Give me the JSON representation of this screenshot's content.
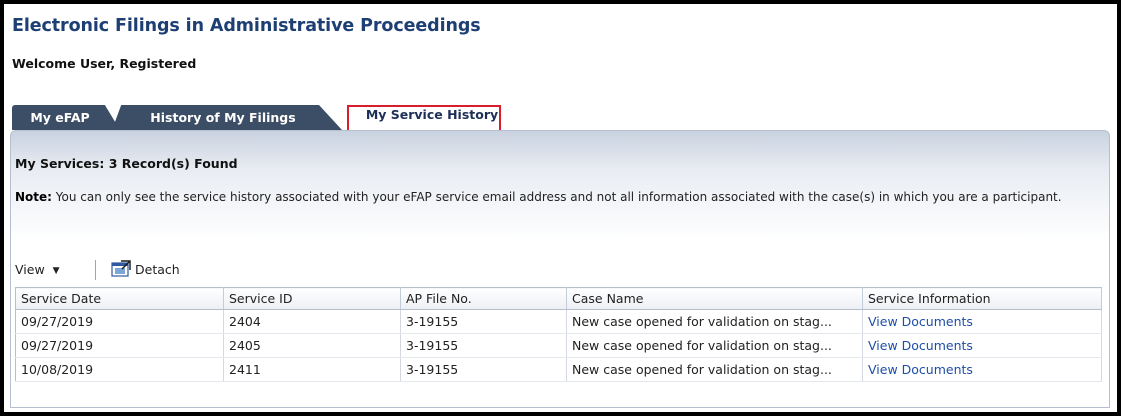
{
  "app": {
    "title": "Electronic Filings in Administrative Proceedings",
    "welcome": "Welcome User, Registered"
  },
  "tabs": [
    {
      "label": "My eFAP",
      "selected": false
    },
    {
      "label": "History of My Filings",
      "selected": false
    },
    {
      "label": "My Service History",
      "selected": true
    }
  ],
  "panel": {
    "heading": "My Services: 3 Record(s) Found",
    "note_label": "Note:",
    "note_text": " You can only see the service history associated with your eFAP service email address and not all information associated with the case(s) in which you are a participant."
  },
  "toolbar": {
    "view_label": "View",
    "detach_label": "Detach"
  },
  "table": {
    "columns": [
      "Service Date",
      "Service ID",
      "AP File No.",
      "Case Name",
      "Service Information"
    ],
    "rows": [
      {
        "date": "09/27/2019",
        "id": "2404",
        "file": "3-19155",
        "case": "New case opened for validation on stag...",
        "info": "View Documents"
      },
      {
        "date": "09/27/2019",
        "id": "2405",
        "file": "3-19155",
        "case": "New case opened for validation on stag...",
        "info": "View Documents"
      },
      {
        "date": "10/08/2019",
        "id": "2411",
        "file": "3-19155",
        "case": "New case opened for validation on stag...",
        "info": "View Documents"
      }
    ]
  },
  "colors": {
    "title": "#1e3f73",
    "tab_inactive": "#3c4d66",
    "highlight_box": "#d81e2a",
    "link": "#1f4ea8"
  },
  "icons": {
    "view_menu": "chevron-down-icon",
    "detach": "detach-window-icon"
  }
}
